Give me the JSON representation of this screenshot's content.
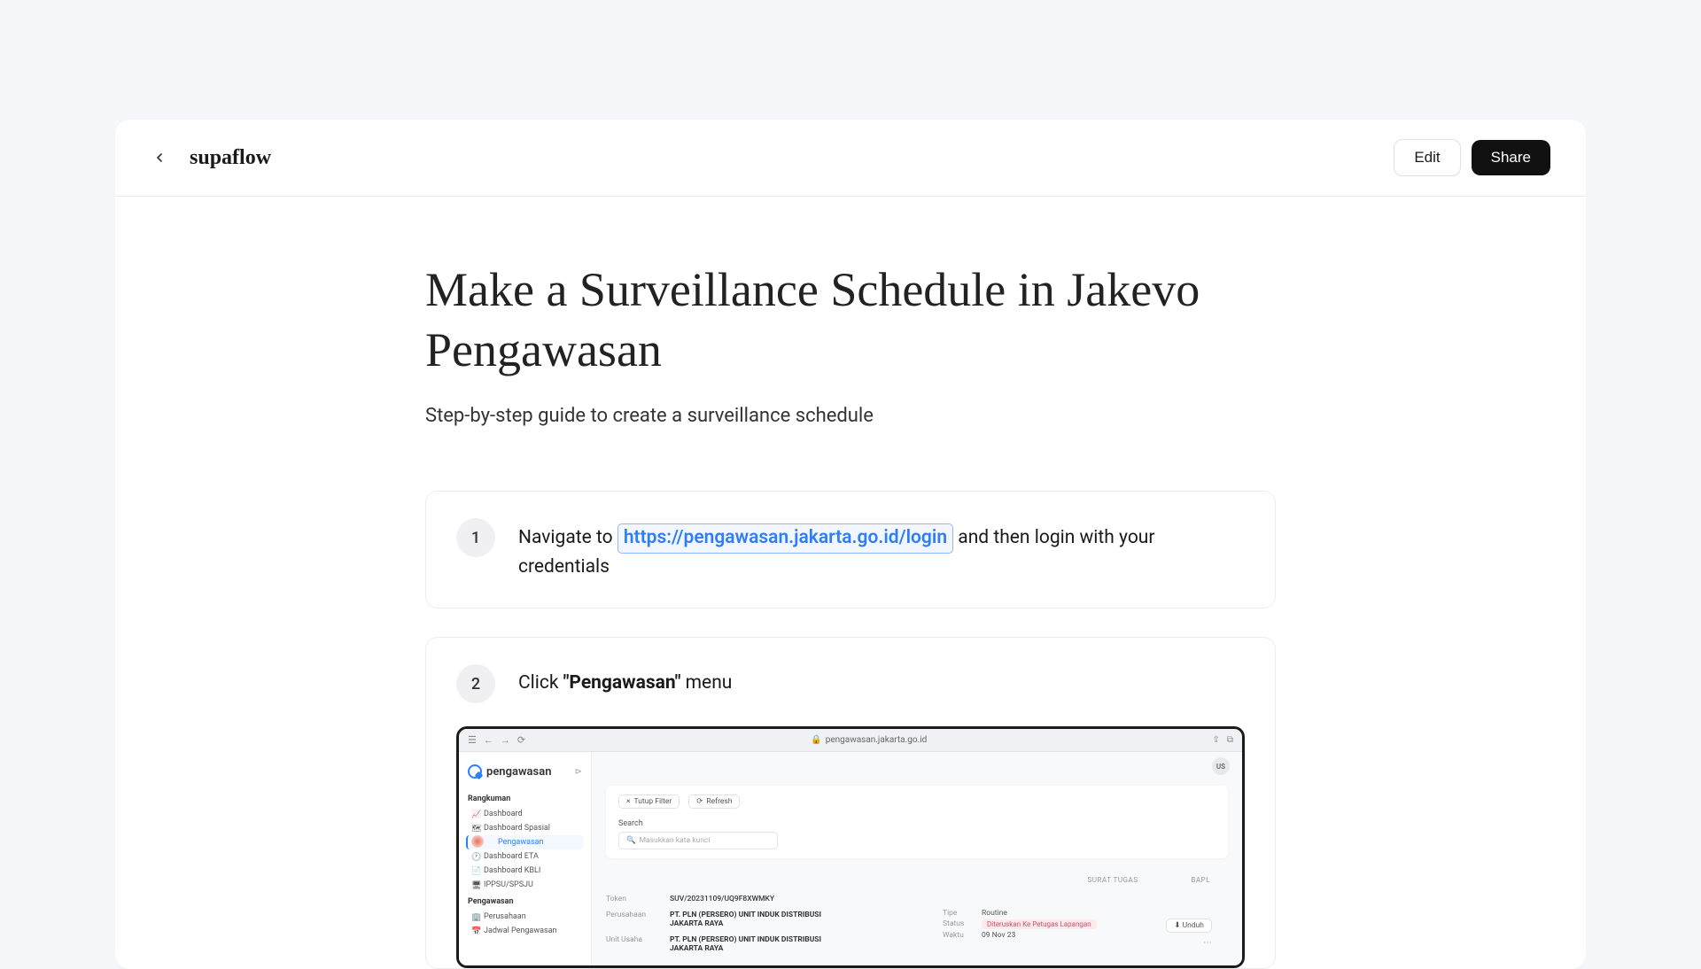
{
  "header": {
    "brand": "supaflow",
    "edit_label": "Edit",
    "share_label": "Share"
  },
  "doc": {
    "title": "Make a Surveillance Schedule in Jakevo Pengawasan",
    "subtitle": "Step-by-step guide to create a surveillance schedule"
  },
  "steps": [
    {
      "number": "1",
      "text_before": "Navigate to ",
      "link": "https://pengawasan.jakarta.go.id/login",
      "text_after": " and then login with your credentials"
    },
    {
      "number": "2",
      "text_before": "Click ",
      "bold": "\"Pengawasan\"",
      "text_after": " menu"
    }
  ],
  "embedded": {
    "url": "pengawasan.jakarta.go.id",
    "logo_text_main": "pengawasan",
    "avatar": "US",
    "sidebar": {
      "section1": "Rangkuman",
      "items1": [
        "Dashboard",
        "Dashboard Spasial",
        "Pengawasan",
        "Dashboard ETA",
        "Dashboard KBLI",
        "IPPSU/SPSJU"
      ],
      "section2": "Pengawasan",
      "items2": [
        "Perusahaan",
        "Jadwal Pengawasan"
      ]
    },
    "panel": {
      "filter_label": "Tutup Filter",
      "refresh_label": "Refresh",
      "search_label": "Search",
      "search_placeholder": "Masukkan kata kunci",
      "col1": "SURAT TUGAS",
      "col2": "BAPL",
      "rows": [
        {
          "label": "Token",
          "value": "SUV/20231109/UQ9F8XWMKY"
        },
        {
          "label": "Perusahaan",
          "value": "PT. PLN (PERSERO) UNIT INDUK DISTRIBUSI JAKARTA RAYA"
        },
        {
          "label": "Unit Usaha",
          "value": "PT. PLN (PERSERO) UNIT INDUK DISTRIBUSI JAKARTA RAYA"
        }
      ],
      "mid": [
        {
          "l": "Tipe",
          "v": "Routine"
        },
        {
          "l": "Status",
          "v": "Diteruskan Ke Petugas Lapangan"
        },
        {
          "l": "Waktu",
          "v": "09 Nov 23"
        }
      ],
      "dl": "Unduh"
    }
  }
}
